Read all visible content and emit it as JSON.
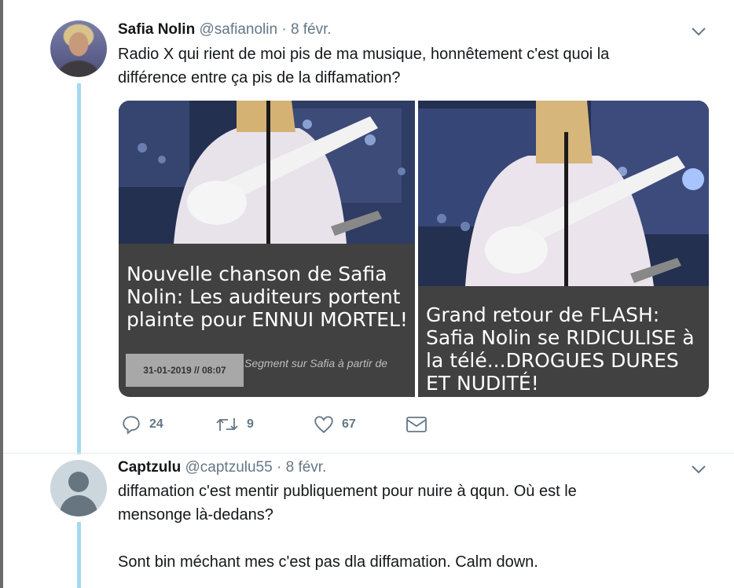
{
  "tweet1": {
    "display_name": "Safia Nolin",
    "handle": "@safianolin",
    "separator": "·",
    "date": "8 févr.",
    "text_line1": "Radio X qui rient de moi pis de ma musique, honnêtement c'est quoi la",
    "text_line2": "différence entre ça pis de la diffamation?",
    "media": {
      "left": {
        "headline": "Nouvelle chanson de Safia Nolin: Les auditeurs portent plainte pour ENNUI MORTEL!",
        "date_box": "31-01-2019 // 08:07",
        "segment_text": "Segment sur Safia à partir de"
      },
      "right": {
        "headline": "Grand retour de FLASH: Safia Nolin se RIDICULISE à la télé...DROGUES DURES ET NUDITÉ!"
      }
    },
    "actions": {
      "reply_count": "24",
      "retweet_count": "9",
      "like_count": "67"
    }
  },
  "tweet2": {
    "display_name": "Captzulu",
    "handle": "@captzulu55",
    "separator": "·",
    "date": "8 févr.",
    "text_line1": "diffamation c'est mentir publiquement pour nuire à qqun. Où est le",
    "text_line2": "mensonge là-dedans?",
    "text_line3": "Sont bin méchant mes c'est pas dla diffamation. Calm down."
  },
  "icons": {
    "reply": "reply-icon",
    "retweet": "retweet-icon",
    "like": "heart-icon",
    "dm": "envelope-icon",
    "caret": "chevron-down-icon"
  },
  "colors": {
    "thread_line": "#a4d9ef",
    "secondary_text": "#657786",
    "primary_text": "#14171a",
    "media_caption_bg": "#414141"
  }
}
